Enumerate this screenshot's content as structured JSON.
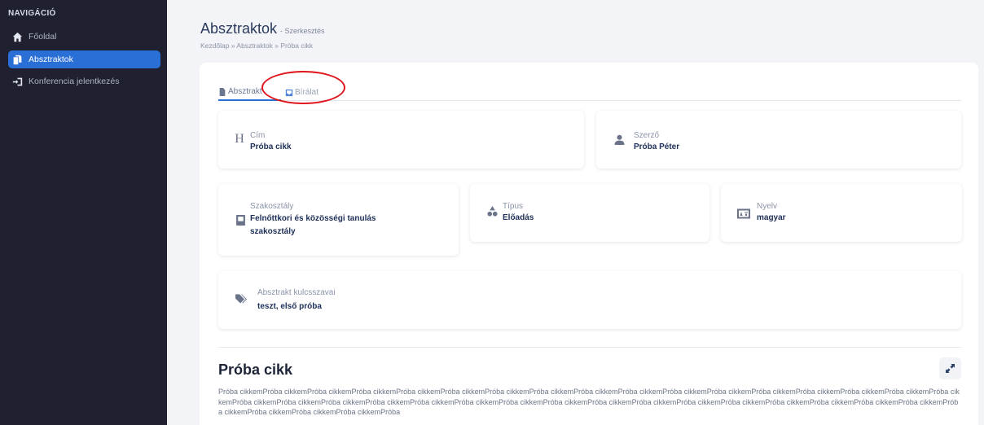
{
  "sidebar": {
    "heading": "NAVIGÁCIÓ",
    "items": [
      {
        "label": "Főoldal",
        "icon": "home-icon",
        "active": false
      },
      {
        "label": "Absztraktok",
        "icon": "documents-icon",
        "active": true
      },
      {
        "label": "Konferencia jelentkezés",
        "icon": "register-icon",
        "active": false
      }
    ]
  },
  "header": {
    "title": "Absztraktok",
    "subtitle": "- Szerkesztés",
    "breadcrumb": "Kezdőlap » Absztraktok » Próba cikk"
  },
  "tabs": [
    {
      "label": "Absztrakt",
      "icon": "document-icon",
      "active": true
    },
    {
      "label": "Bírálat",
      "icon": "inbox-icon",
      "active": false
    }
  ],
  "fields": {
    "cim": {
      "label": "Cím",
      "value": "Próba cikk",
      "icon": "heading-icon"
    },
    "szerzo": {
      "label": "Szerző",
      "value": "Próba Péter",
      "icon": "user-icon"
    },
    "szakosztaly": {
      "label": "Szakosztály",
      "value_line1": "Felnőttkori és közösségi tanulás",
      "value_line2": "szakosztály",
      "icon": "book-icon"
    },
    "tipus": {
      "label": "Típus",
      "value": "Előadás",
      "icon": "shapes-icon"
    },
    "nyelv": {
      "label": "Nyelv",
      "value": "magyar",
      "icon": "language-icon"
    },
    "kulcsszavak": {
      "label": "Absztrakt kulcsszavai",
      "value": "teszt, első próba",
      "icon": "tags-icon"
    }
  },
  "article": {
    "title": "Próba cikk",
    "body": "Próba cikkemPróba cikkemPróba cikkemPróba cikkemPróba cikkemPróba cikkemPróba cikkemPróba cikkemPróba cikkemPróba cikkemPróba cikkemPróba cikkemPróba cikkemPróba cikkemPróba cikkemPróba cikkemPróba cikkemPróba cikkemPróba cikkemPróba cikkemPróba cikkemPróba cikkemPróba cikkemPróba cikkemPróba cikkemPróba cikkemPróba cikkemPróba cikkemPróba cikkemPróba cikkemPróba cikkemPróba cikkemPróba cikkemPróba cikkemPróba cikkemPróba cikkemPróba cikkemPróba"
  },
  "colors": {
    "sidebar_bg": "#1f2130",
    "accent": "#2a6fd6",
    "annotation_ring": "#e0141a"
  }
}
